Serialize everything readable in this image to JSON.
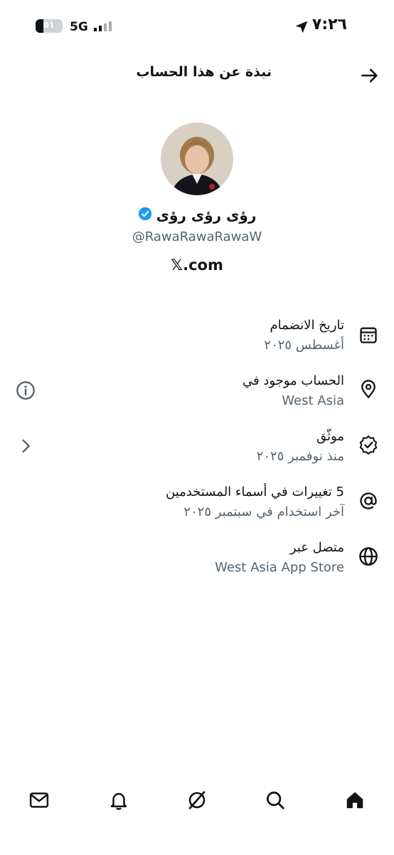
{
  "status_bar": {
    "time": "٧:٢٦",
    "network": "5G",
    "battery": "٥١"
  },
  "header": {
    "title": "نبذة عن هذا الحساب"
  },
  "profile": {
    "name": "رؤى رؤى رؤى",
    "handle": "@RawaRawaRawaW",
    "site": "𝕏.com"
  },
  "rows": [
    {
      "icon": "calendar-icon",
      "title": "تاريخ الانضمام",
      "subtitle": "أغسطس ٢٠٢٥"
    },
    {
      "icon": "location-pin-icon",
      "title": "الحساب موجود في",
      "subtitle": "West Asia"
    },
    {
      "icon": "verified-badge-icon",
      "title": "موثّق",
      "subtitle": "منذ نوفمبر ٢٠٢٥"
    },
    {
      "icon": "at-sign-icon",
      "title": "5 تغييرات في أسماء المستخدمين",
      "subtitle": "آخر استخدام في سبتمبر ٢٠٢٥"
    },
    {
      "icon": "globe-icon",
      "title": "متصل عبر",
      "subtitle": "West Asia App Store"
    }
  ],
  "colors": {
    "text": "#0f1419",
    "secondary": "#536471",
    "verified": "#1d9bf0"
  }
}
